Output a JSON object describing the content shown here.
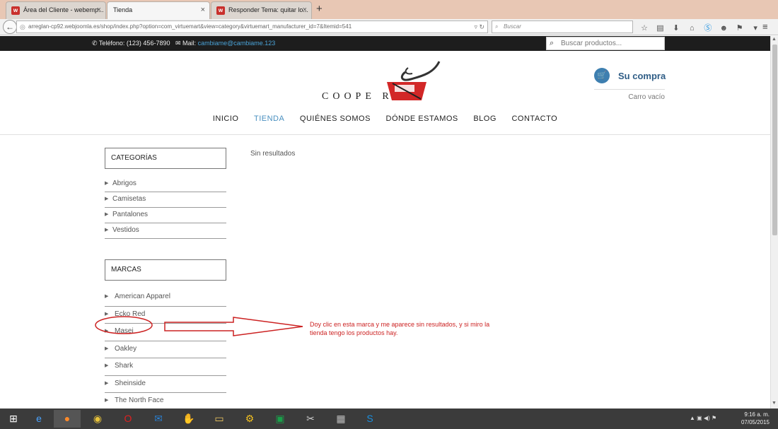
{
  "browser": {
    "tabs": [
      {
        "label": "Área del Cliente - webemp...",
        "favicon": "w"
      },
      {
        "label": "Tienda",
        "favicon": "w"
      },
      {
        "label": "Responder Tema: quitar lo...",
        "favicon": "w"
      }
    ],
    "new_tab_symbol": "+",
    "url": "arreglan-cp92.webjoomla.es/shop/index.php?option=com_virtuemart&view=category&virtuemart_manufacturer_id=7&Itemid=541",
    "search_placeholder": "Buscar"
  },
  "topbar": {
    "phone": "Teléfono: (123) 456-7890",
    "mail_label": "Mail:",
    "mail_value": "cambiame@cambiame.123",
    "search_placeholder": "Buscar productos..."
  },
  "logo": {
    "text": "COOPE       R"
  },
  "cart": {
    "title": "Su compra",
    "status": "Carro vacío"
  },
  "nav": {
    "items": [
      "INICIO",
      "TIENDA",
      "QUIÉNES SOMOS",
      "DÓNDE ESTAMOS",
      "BLOG",
      "CONTACTO"
    ],
    "active": "TIENDA",
    "active_color": "#4a90c0"
  },
  "categories": {
    "title": "CATEGORÍAS",
    "items": [
      "Abrigos",
      "Camisetas",
      "Pantalones",
      "Vestidos"
    ]
  },
  "brands": {
    "title": "MARCAS",
    "items": [
      "American Apparel",
      "Ecko Red",
      "Masei",
      "Oakley",
      "Shark",
      "Sheinside",
      "The North Face"
    ]
  },
  "main": {
    "message": "Sin resultados"
  },
  "annotation": {
    "text": "Doy clic en esta marca y me aparece sin resultados, y si miro la tienda tengo los productos hay.",
    "color": "#cc2222"
  },
  "taskbar": {
    "time": "9:16 a. m.",
    "date": "07/05/2015"
  }
}
